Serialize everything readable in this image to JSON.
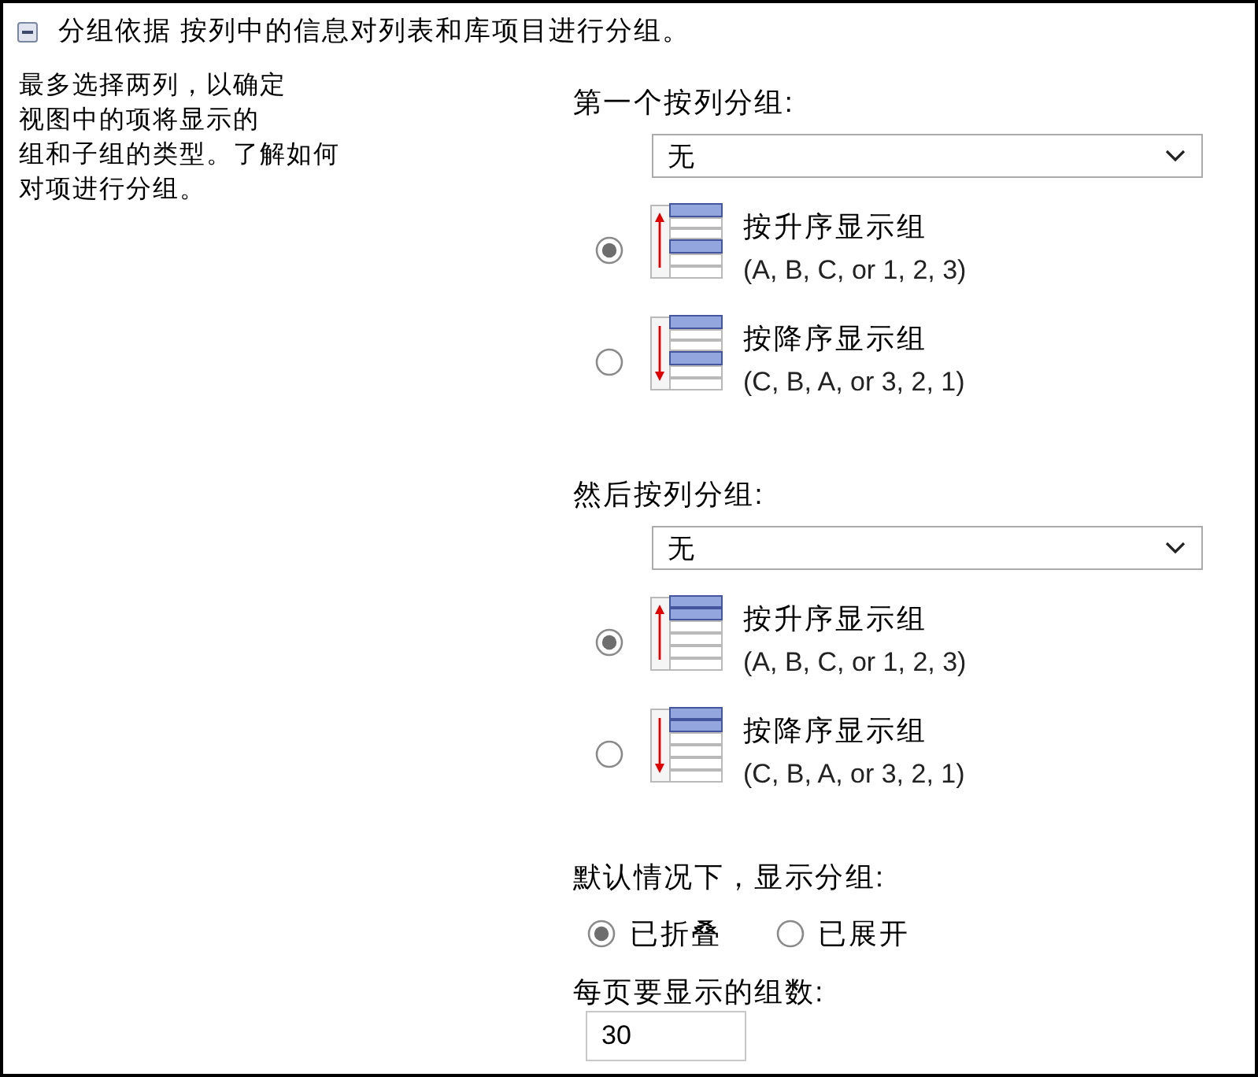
{
  "header": {
    "expanded": true,
    "text": "分组依据 按列中的信息对列表和库项目进行分组。"
  },
  "description": {
    "lines": [
      "最多选择两列，以确定",
      "视图中的项将显示的",
      "组和子组的类型。了解如何",
      "对项进行分组。"
    ]
  },
  "sections": [
    {
      "kind": "group",
      "label": "第一个按列分组:",
      "dropdown": {
        "value": "无"
      },
      "options": [
        {
          "kind": "ascending",
          "label": "按升序显示组",
          "hint": "(A, B, C, or 1, 2, 3)",
          "selected": true
        },
        {
          "kind": "descending",
          "label": "按降序显示组",
          "hint": "(C, B, A, or 3, 2, 1)",
          "selected": false
        }
      ]
    },
    {
      "kind": "subgroup",
      "label": "然后按列分组:",
      "dropdown": {
        "value": "无"
      },
      "options": [
        {
          "kind": "ascending",
          "label": "按升序显示组",
          "hint": "(A, B, C, or 1, 2, 3)",
          "selected": true
        },
        {
          "kind": "descending",
          "label": "按降序显示组",
          "hint": "(C, B, A, or 3, 2, 1)",
          "selected": false
        }
      ]
    }
  ],
  "default_display": {
    "label": "默认情况下，显示分组:",
    "options": [
      {
        "label": "已折叠",
        "selected": true
      },
      {
        "label": "已展开",
        "selected": false
      }
    ]
  },
  "groups_per_page": {
    "label": "每页要显示的组数:",
    "value": "30"
  }
}
